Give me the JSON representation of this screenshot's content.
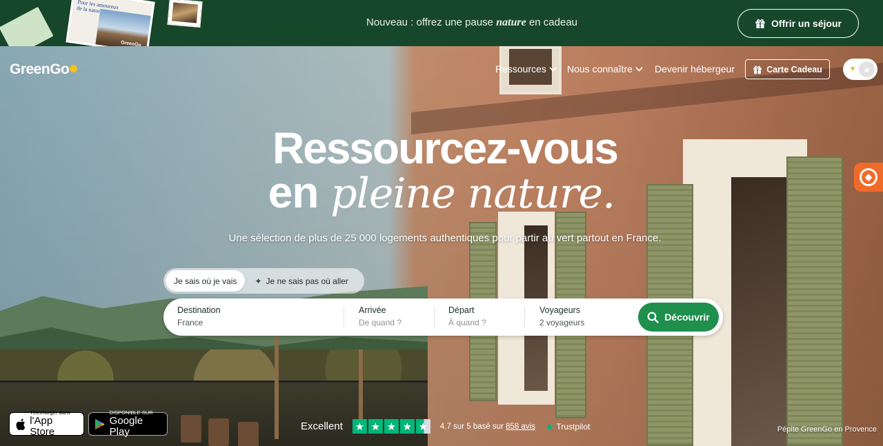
{
  "promo": {
    "text_before": "Nouveau : offrez une pause",
    "text_em": "nature",
    "text_after": "en cadeau",
    "card_text": "Pour les amoureux de la nature",
    "card_brand": "GreenGo",
    "button_label": "Offrir un séjour"
  },
  "header": {
    "logo": "GreenGo",
    "nav": [
      {
        "label": "Ressources",
        "has_dropdown": true
      },
      {
        "label": "Nous connaître",
        "has_dropdown": true
      },
      {
        "label": "Devenir hébergeur",
        "has_dropdown": false
      }
    ],
    "gift_card_label": "Carte Cadeau"
  },
  "hero": {
    "title_line1": "Ressourcez-vous",
    "title_line2_plain": "en",
    "title_line2_italic": "pleine nature.",
    "subtitle": "Une sélection de plus de 25 000 logements authentiques pour partir au vert partout en France."
  },
  "search": {
    "toggle": [
      {
        "label": "Je sais où je vais",
        "active": true
      },
      {
        "label": "Je ne sais pas où aller",
        "active": false
      }
    ],
    "fields": [
      {
        "label": "Destination",
        "value": "France",
        "placeholder": false
      },
      {
        "label": "Arrivée",
        "value": "De quand ?",
        "placeholder": true
      },
      {
        "label": "Départ",
        "value": "À quand ?",
        "placeholder": true
      },
      {
        "label": "Voyageurs",
        "value": "2 voyageurs",
        "placeholder": false
      }
    ],
    "button_label": "Découvrir"
  },
  "apps": {
    "appstore_small": "Télécharger dans",
    "appstore_big": "l'App Store",
    "gplay_small": "DISPONIBLE SUR",
    "gplay_big": "Google Play"
  },
  "trustpilot": {
    "label": "Excellent",
    "rating": 4.7,
    "stars_full": 4,
    "text_prefix": "4.7 sur 5 basé sur",
    "reviews_link": "858 avis",
    "brand": "Trustpilot"
  },
  "photo_caption": "Pépite GreenGo en Provence",
  "colors": {
    "banner": "#17472b",
    "accent_green": "#1f8f4e",
    "trustpilot_green": "#00b67a",
    "badge_orange": "#f06b2a"
  },
  "icons": [
    "gift-icon",
    "chevron-down-icon",
    "heart-icon",
    "user-icon",
    "search-icon",
    "sparkle-icon",
    "apple-icon",
    "google-play-icon",
    "star-icon",
    "trustpilot-star-icon",
    "badge-icon"
  ]
}
